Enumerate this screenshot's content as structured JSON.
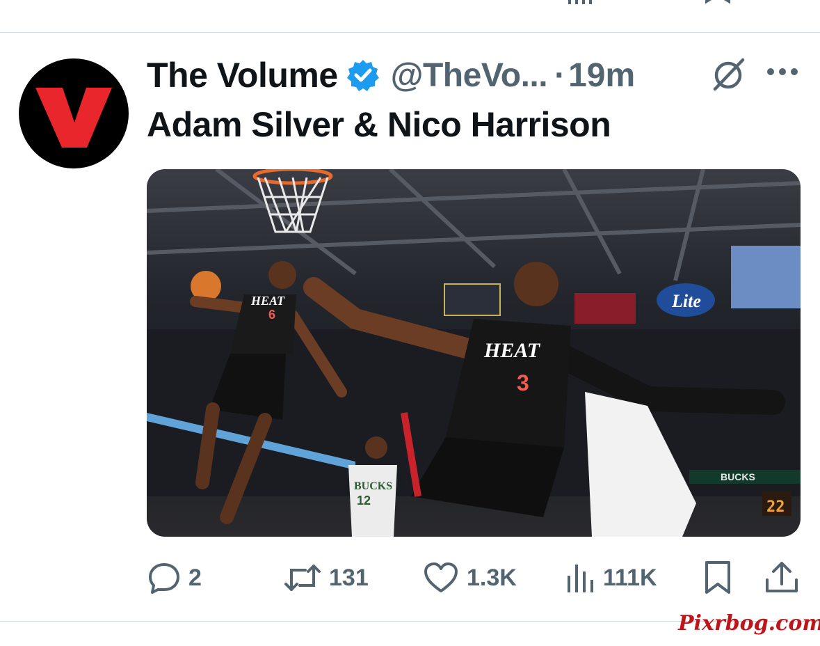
{
  "tweet": {
    "author_name": "The Volume",
    "handle": "@TheVo...",
    "separator": "·",
    "time": "19m",
    "text": "Adam Silver & Nico Harrison",
    "avatar_letter": "V"
  },
  "media": {
    "jersey_left_team": "HEAT",
    "jersey_left_number": "6",
    "jersey_right_team": "HEAT",
    "jersey_right_number": "3",
    "jersey_bucks_team": "BUCKS",
    "jersey_bucks_number": "12",
    "board_brand": "Lite",
    "scoreboard_team": "BUCKS",
    "shot_clock": "22"
  },
  "actions": {
    "replies": "2",
    "reposts": "131",
    "likes": "1.3K",
    "views": "111K"
  },
  "watermark": "Pixrbog.com",
  "colors": {
    "text_primary": "#0f1419",
    "text_secondary": "#536471",
    "verified": "#1d9bf0",
    "avatar_accent": "#e8262c"
  },
  "icons": [
    "reply-icon",
    "repost-icon",
    "like-icon",
    "views-icon",
    "bookmark-icon",
    "share-icon",
    "verified-badge-icon",
    "grok-icon",
    "more-icon"
  ]
}
